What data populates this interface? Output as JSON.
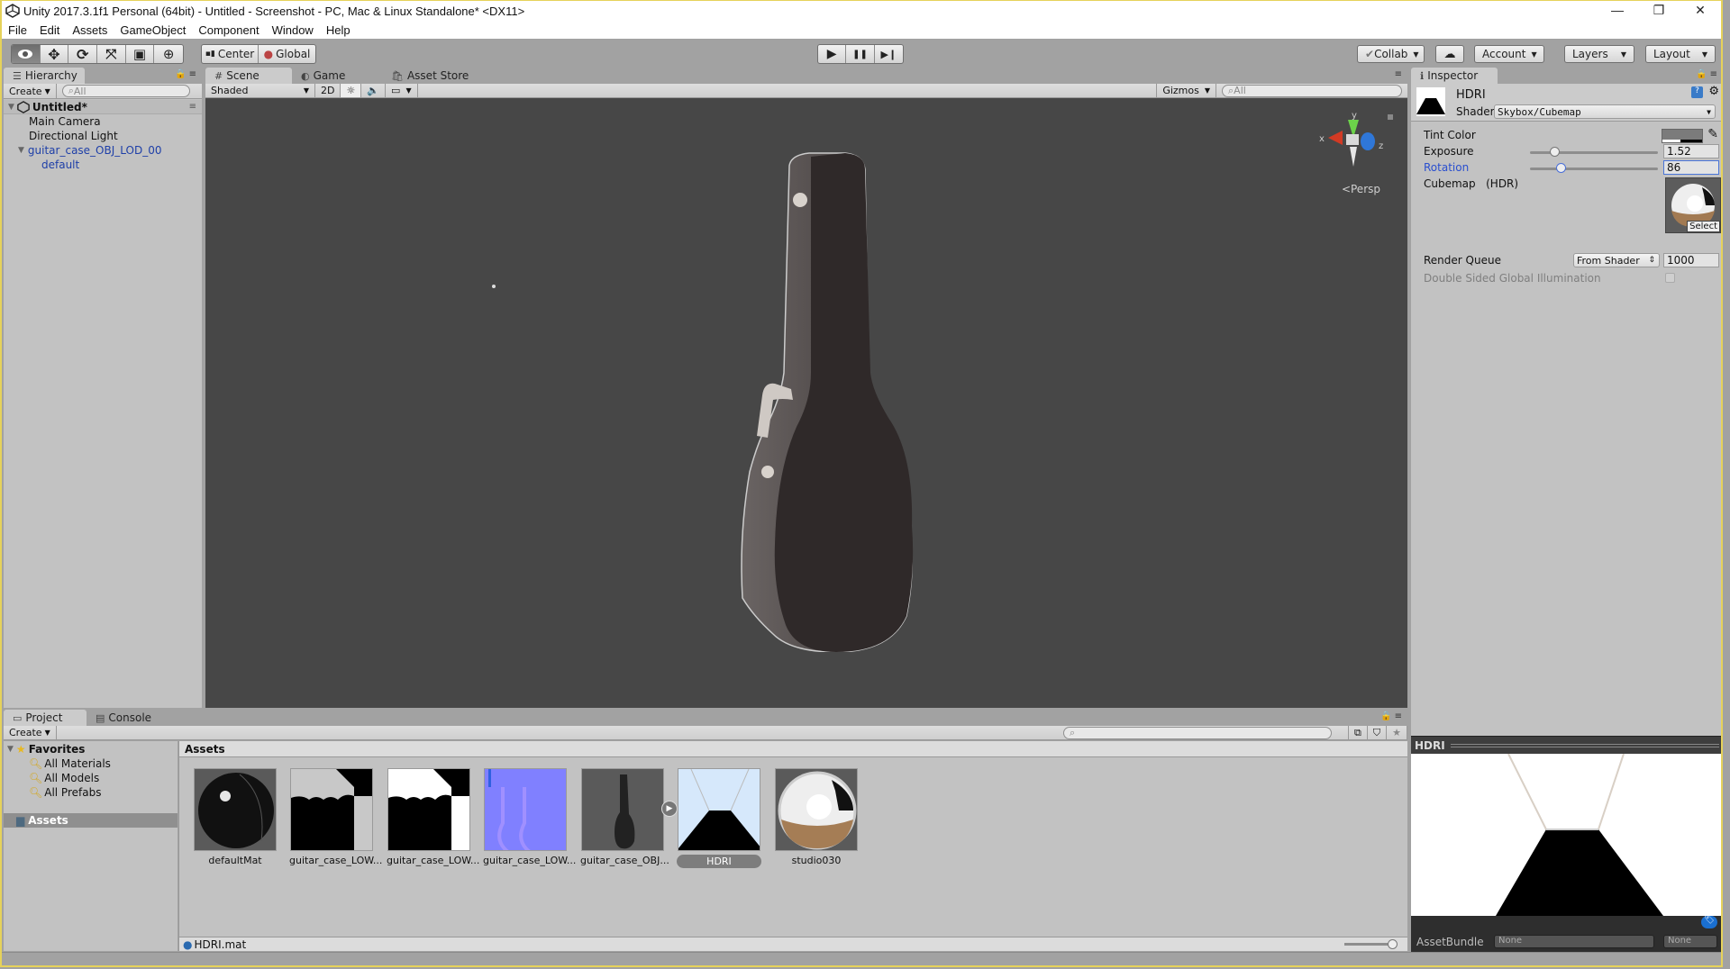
{
  "window": {
    "title": "Unity 2017.3.1f1 Personal (64bit) - Untitled - Screenshot - PC, Mac & Linux Standalone* <DX11>",
    "controls": {
      "minimize": "—",
      "restore": "❐",
      "close": "✕"
    }
  },
  "menu": [
    "File",
    "Edit",
    "Assets",
    "GameObject",
    "Component",
    "Window",
    "Help"
  ],
  "toolbar": {
    "tools": [
      {
        "name": "view-tool",
        "glyph": "👁",
        "active": true
      },
      {
        "name": "move-tool",
        "glyph": "✥"
      },
      {
        "name": "rotate-tool",
        "glyph": "⟳"
      },
      {
        "name": "scale-tool",
        "glyph": "⤧"
      },
      {
        "name": "rect-tool",
        "glyph": "▣"
      },
      {
        "name": "transform-tool",
        "glyph": "⊕"
      }
    ],
    "pivot": "Center",
    "space": "Global",
    "play": "▶",
    "pause": "❚❚",
    "step": "▶❙",
    "collab": "Collab",
    "cloud": "☁",
    "account": "Account",
    "layers": "Layers",
    "layout": "Layout"
  },
  "hierarchy": {
    "tab": "Hierarchy",
    "create": "Create",
    "search_placeholder": "All",
    "scene_name": "Untitled*",
    "items": [
      {
        "label": "Main Camera",
        "depth": 1,
        "prefab": false
      },
      {
        "label": "Directional Light",
        "depth": 1,
        "prefab": false
      },
      {
        "label": "guitar_case_OBJ_LOD_00",
        "depth": 1,
        "prefab": true,
        "expanded": true
      },
      {
        "label": "default",
        "depth": 2,
        "prefab": true
      }
    ]
  },
  "scene_view": {
    "tabs": [
      "Scene",
      "Game",
      "Asset Store"
    ],
    "active_tab": "Scene",
    "draw_mode": "Shaded",
    "toggle_2d": "2D",
    "gizmos": "Gizmos",
    "search_placeholder": "All",
    "projection": "Persp",
    "axes": {
      "x": "x",
      "y": "y",
      "z": "z"
    }
  },
  "inspector": {
    "tab": "Inspector",
    "material_name": "HDRI",
    "shader_label": "Shader",
    "shader_value": "Skybox/Cubemap",
    "properties": {
      "tint_color": {
        "label": "Tint Color",
        "color": "#808080"
      },
      "exposure": {
        "label": "Exposure",
        "value": "1.52",
        "slider_fraction": 0.19
      },
      "rotation": {
        "label": "Rotation",
        "value": "86",
        "slider_fraction": 0.24
      },
      "cubemap": {
        "label": "Cubemap",
        "hint": "(HDR)",
        "select": "Select"
      }
    },
    "render_queue": {
      "label": "Render Queue",
      "mode": "From Shader",
      "value": "1000"
    },
    "double_sided_gi": {
      "label": "Double Sided Global Illumination",
      "checked": false
    },
    "preview_title": "HDRI",
    "asset_bundle": {
      "label": "AssetBundle",
      "name": "None",
      "variant": "None"
    }
  },
  "project": {
    "tabs": [
      "Project",
      "Console"
    ],
    "active_tab": "Project",
    "create": "Create",
    "favorites_label": "Favorites",
    "favorites": [
      "All Materials",
      "All Models",
      "All Prefabs"
    ],
    "root_folder": "Assets",
    "breadcrumb": "Assets",
    "assets": [
      {
        "label": "defaultMat",
        "type": "material"
      },
      {
        "label": "guitar_case_LOW...",
        "type": "texture-gray"
      },
      {
        "label": "guitar_case_LOW...",
        "type": "texture-white"
      },
      {
        "label": "guitar_case_LOW...",
        "type": "texture-normal"
      },
      {
        "label": "guitar_case_OBJ...",
        "type": "model"
      },
      {
        "label": "HDRI",
        "type": "skybox",
        "selected": true
      },
      {
        "label": "studio030",
        "type": "cubemap"
      }
    ],
    "selected_path": "HDRI.mat",
    "thumb_size_fraction": 0.95
  }
}
